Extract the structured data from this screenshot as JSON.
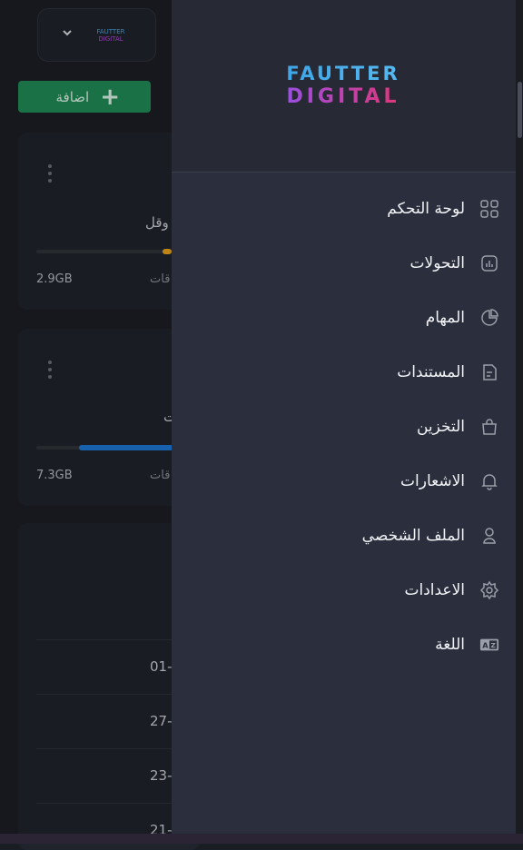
{
  "brand": {
    "line1": "FAUTTER",
    "line2": "DIGITAL",
    "colors": {
      "blue": "#3ea6e8",
      "purple": "#9b4fe0",
      "pink": "#e0367a"
    }
  },
  "topbar": {
    "dropdown_icon": "chevron-down-icon"
  },
  "add_button": {
    "label": "اضافة",
    "icon": "plus-icon",
    "color": "#1f8a55"
  },
  "cards": [
    {
      "title": "وقل",
      "used": "2.9GB",
      "free": "قات",
      "fill_color": "#e8a21c",
      "fill_fraction": 0.05
    },
    {
      "title": "ت",
      "used": "7.3GB",
      "free": "قات",
      "fill_color": "#1b76d2",
      "fill_fraction": 0.6
    }
  ],
  "list_rows": [
    "01-",
    "27-",
    "23-",
    "21-"
  ],
  "drawer": {
    "menu": [
      {
        "label": "لوحة التحكم",
        "icon": "dashboard-icon"
      },
      {
        "label": "التحولات",
        "icon": "chart-icon"
      },
      {
        "label": "المهام",
        "icon": "pie-chart-icon"
      },
      {
        "label": "المستندات",
        "icon": "document-icon"
      },
      {
        "label": "التخزين",
        "icon": "bag-icon"
      },
      {
        "label": "الاشعارات",
        "icon": "bell-icon"
      },
      {
        "label": "الملف الشخصي",
        "icon": "user-icon"
      },
      {
        "label": "الاعدادات",
        "icon": "gear-icon"
      },
      {
        "label": "اللغة",
        "icon": "translate-icon"
      }
    ]
  }
}
